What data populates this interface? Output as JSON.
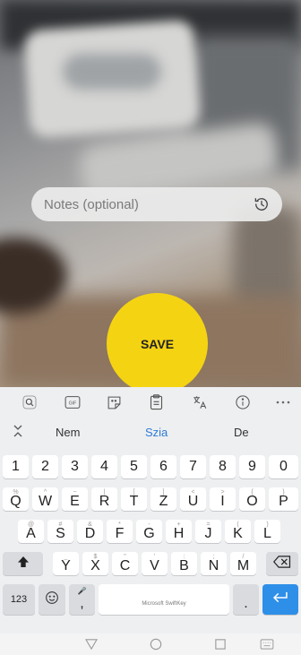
{
  "notes": {
    "placeholder": "Notes (optional)",
    "icon": "history-icon"
  },
  "save_button": {
    "label": "SAVE",
    "color": "#f4d313"
  },
  "keyboard": {
    "toolbar_icons": [
      "search-icon",
      "gif-icon",
      "sticker-icon",
      "clipboard-icon",
      "translate-icon",
      "info-icon",
      "more-icon"
    ],
    "suggestions": {
      "collapse_icon": "collapse-icon",
      "items": [
        "Nem",
        "Szia",
        "De"
      ],
      "highlight_color": "#2e7bd6"
    },
    "number_row": [
      "1",
      "2",
      "3",
      "4",
      "5",
      "6",
      "7",
      "8",
      "9",
      "0"
    ],
    "row1": [
      {
        "key": "Q",
        "sub": "%"
      },
      {
        "key": "W",
        "sub": "^"
      },
      {
        "key": "E",
        "sub": "~"
      },
      {
        "key": "R",
        "sub": "|"
      },
      {
        "key": "T",
        "sub": "["
      },
      {
        "key": "Z",
        "sub": "]"
      },
      {
        "key": "U",
        "sub": "<"
      },
      {
        "key": "I",
        "sub": ">"
      },
      {
        "key": "O",
        "sub": "{"
      },
      {
        "key": "P",
        "sub": "}"
      }
    ],
    "row2": [
      {
        "key": "A",
        "sub": "@"
      },
      {
        "key": "S",
        "sub": "#"
      },
      {
        "key": "D",
        "sub": "&"
      },
      {
        "key": "F",
        "sub": "*"
      },
      {
        "key": "G",
        "sub": "-"
      },
      {
        "key": "H",
        "sub": "+"
      },
      {
        "key": "J",
        "sub": "="
      },
      {
        "key": "K",
        "sub": "("
      },
      {
        "key": "L",
        "sub": ")"
      }
    ],
    "row3": [
      {
        "key": "Y",
        "sub": "_"
      },
      {
        "key": "X",
        "sub": "$"
      },
      {
        "key": "C",
        "sub": "\""
      },
      {
        "key": "V",
        "sub": "'"
      },
      {
        "key": "B",
        "sub": ":"
      },
      {
        "key": "N",
        "sub": ";"
      },
      {
        "key": "M",
        "sub": "/"
      }
    ],
    "numbers_key": "123",
    "space_label": "Microsoft SwiftKey",
    "comma_key": ",",
    "period_key": ".",
    "enter_color": "#2e8fe8"
  }
}
